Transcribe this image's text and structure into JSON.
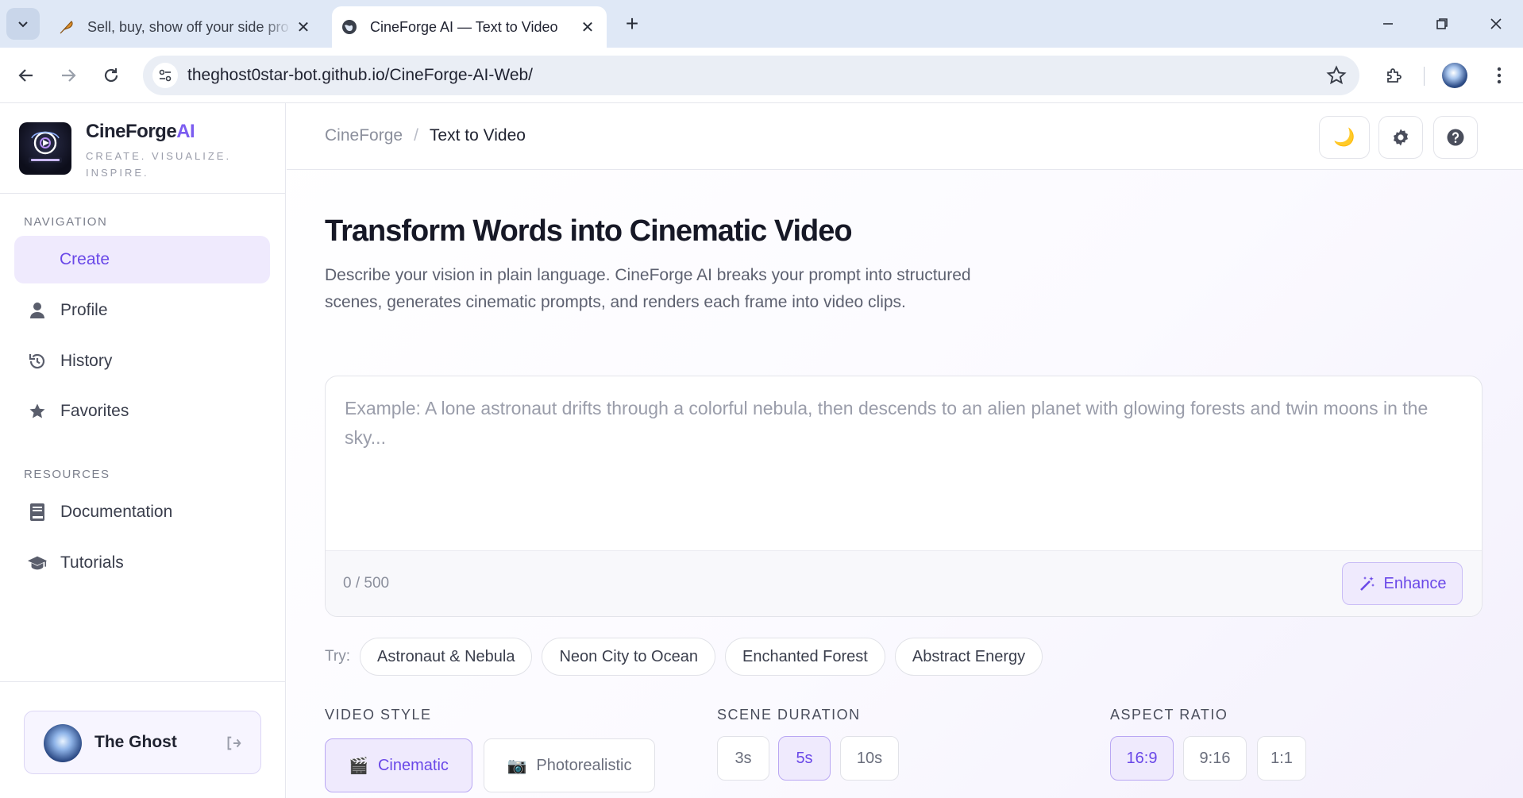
{
  "browser": {
    "tabs": [
      {
        "title": "Sell, buy, show off your side pro",
        "close": "✕",
        "active": false
      },
      {
        "title": "CineForge AI — Text to Video",
        "close": "✕",
        "active": true
      }
    ],
    "new_tab": "+",
    "url": "theghost0star-bot.github.io/CineForge-AI-Web/"
  },
  "sidebar": {
    "brand": {
      "name": "CineForge",
      "name_accent": "AI",
      "tagline": "CREATE. VISUALIZE. INSPIRE."
    },
    "navigation_label": "NAVIGATION",
    "nav_items": [
      {
        "label": "Create",
        "icon": "none",
        "active": true
      },
      {
        "label": "Profile",
        "icon": "user-icon",
        "active": false
      },
      {
        "label": "History",
        "icon": "history-icon",
        "active": false
      },
      {
        "label": "Favorites",
        "icon": "star-icon",
        "active": false
      }
    ],
    "resources_label": "RESOURCES",
    "resource_items": [
      {
        "label": "Documentation",
        "icon": "book-icon"
      },
      {
        "label": "Tutorials",
        "icon": "graduation-cap-icon"
      }
    ],
    "user": {
      "name": "The Ghost"
    }
  },
  "topbar": {
    "breadcrumb_root": "CineForge",
    "breadcrumb_sep": "/",
    "breadcrumb_current": "Text to Video",
    "theme_icon": "🌙"
  },
  "hero": {
    "title": "Transform Words into Cinematic Video",
    "description": "Describe your vision in plain language. CineForge AI breaks your prompt into structured scenes, generates cinematic prompts, and renders each frame into video clips."
  },
  "prompt": {
    "placeholder": "Example: A lone astronaut drifts through a colorful nebula, then descends to an alien planet with glowing forests and twin moons in the sky...",
    "char_count": "0 / 500",
    "enhance_label": "Enhance"
  },
  "try": {
    "label": "Try:",
    "chips": [
      "Astronaut & Nebula",
      "Neon City to Ocean",
      "Enchanted Forest",
      "Abstract Energy"
    ]
  },
  "options": {
    "video_style": {
      "label": "VIDEO STYLE",
      "choices": [
        "Cinematic",
        "Photorealistic"
      ],
      "selected": "Cinematic",
      "icons": [
        "🎬",
        "📷"
      ]
    },
    "scene_duration": {
      "label": "SCENE DURATION",
      "choices": [
        "3s",
        "5s",
        "10s"
      ],
      "selected": "5s"
    },
    "aspect_ratio": {
      "label": "ASPECT RATIO",
      "choices": [
        "16:9",
        "9:16",
        "1:1"
      ],
      "selected": "16:9"
    }
  },
  "colors": {
    "accent": "#6a48e8",
    "accent_bg": "#efeafd",
    "tabstrip": "#dfe8f6"
  }
}
